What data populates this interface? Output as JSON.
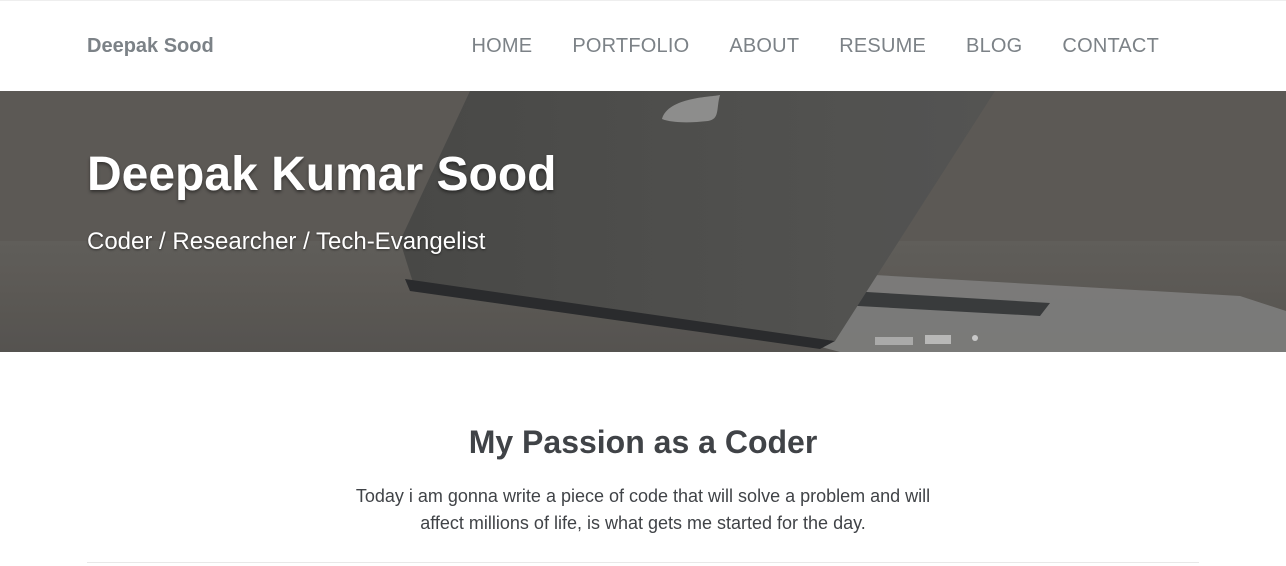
{
  "brand": "Deepak Sood",
  "nav": [
    "HOME",
    "PORTFOLIO",
    "ABOUT",
    "RESUME",
    "BLOG",
    "CONTACT"
  ],
  "hero": {
    "title": "Deepak Kumar Sood",
    "subtitle": "Coder / Researcher / Tech-Evangelist"
  },
  "section": {
    "heading": "My Passion as a Coder",
    "text": "Today i am gonna write a piece of code that will solve a problem and will affect millions of life, is what gets me started for the day."
  },
  "colors": {
    "nav_text": "#7c8287",
    "heading_text": "#404347"
  }
}
